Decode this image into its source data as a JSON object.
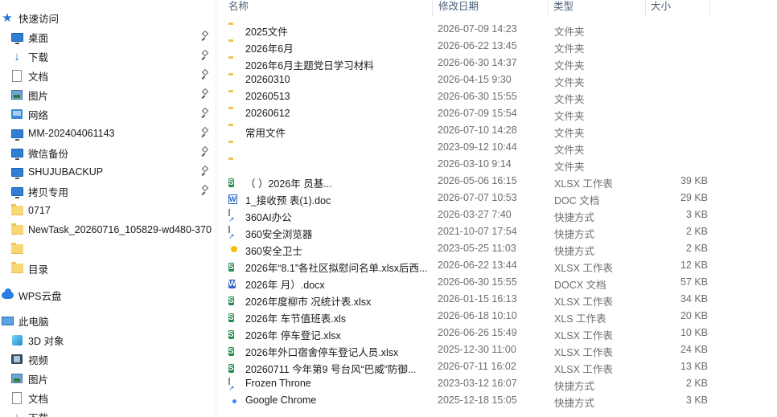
{
  "nav": {
    "quick_access": "快速访问",
    "items": [
      {
        "label": "桌面",
        "icon": "desktop-icon",
        "pinned": true
      },
      {
        "label": "下载",
        "icon": "download-icon",
        "pinned": true
      },
      {
        "label": "文档",
        "icon": "documents-icon",
        "pinned": true
      },
      {
        "label": "图片",
        "icon": "pictures-icon",
        "pinned": true
      },
      {
        "label": "网络",
        "icon": "network-icon",
        "pinned": true
      },
      {
        "label": "MM-202404061143",
        "icon": "computer-icon",
        "pinned": true
      },
      {
        "label": "微信备份",
        "icon": "computer-icon",
        "pinned": true
      },
      {
        "label": "SHUJUBACKUP",
        "icon": "computer-icon",
        "pinned": true
      },
      {
        "label": "拷贝专用",
        "icon": "computer-icon",
        "pinned": true
      },
      {
        "label": "0717",
        "icon": "folder-icon",
        "pinned": false
      },
      {
        "label": "NewTask_20260716_105829-wd480-370",
        "icon": "folder-icon",
        "pinned": false
      },
      {
        "label": "",
        "icon": "folder-icon",
        "pinned": false
      },
      {
        "label": "目录",
        "icon": "folder-icon",
        "pinned": false
      }
    ],
    "wps_cloud": "WPS云盘",
    "this_pc": "此电脑",
    "pc_items": [
      {
        "label": "3D 对象",
        "icon": "3d-objects-icon"
      },
      {
        "label": "视频",
        "icon": "videos-icon"
      },
      {
        "label": "图片",
        "icon": "pictures-icon"
      },
      {
        "label": "文档",
        "icon": "documents-icon"
      },
      {
        "label": "下载",
        "icon": "download-icon"
      }
    ]
  },
  "list": {
    "columns": {
      "name": "名称",
      "date": "修改日期",
      "type": "类型",
      "size": "大小"
    },
    "files": [
      {
        "name": "2025文件",
        "date": "2026-07-09 14:23",
        "type": "文件夹",
        "size": "",
        "icon": "folder-icon"
      },
      {
        "name": "2026年6月",
        "date": "2026-06-22 13:45",
        "type": "文件夹",
        "size": "",
        "icon": "folder-icon"
      },
      {
        "name": "2026年6月主题党日学习材料",
        "date": "2026-06-30 14:37",
        "type": "文件夹",
        "size": "",
        "icon": "folder-icon"
      },
      {
        "name": "20260310",
        "date": "2026-04-15 9:30",
        "type": "文件夹",
        "size": "",
        "icon": "folder-icon"
      },
      {
        "name": "20260513",
        "date": "2026-06-30 15:55",
        "type": "文件夹",
        "size": "",
        "icon": "folder-icon"
      },
      {
        "name": "20260612",
        "date": "2026-07-09 15:54",
        "type": "文件夹",
        "size": "",
        "icon": "folder-icon"
      },
      {
        "name": "常用文件",
        "date": "2026-07-10 14:28",
        "type": "文件夹",
        "size": "",
        "icon": "folder-icon"
      },
      {
        "name": "",
        "date": "2023-09-12 10:44",
        "type": "文件夹",
        "size": "",
        "icon": "folder-icon"
      },
      {
        "name": "",
        "date": "2026-03-10 9:14",
        "type": "文件夹",
        "size": "",
        "icon": "folder-icon"
      },
      {
        "name": "（ ）2026年 员基...",
        "date": "2026-05-06 16:15",
        "type": "XLSX 工作表",
        "size": "39 KB",
        "icon": "xlsx-icon"
      },
      {
        "name": "1_接收预 表(1).doc",
        "date": "2026-07-07 10:53",
        "type": "DOC 文档",
        "size": "29 KB",
        "icon": "doc-icon"
      },
      {
        "name": "360AI办公",
        "date": "2026-03-27 7:40",
        "type": "快捷方式",
        "size": "3 KB",
        "icon": "shortcut-icon"
      },
      {
        "name": "360安全浏览器",
        "date": "2021-10-07 17:54",
        "type": "快捷方式",
        "size": "2 KB",
        "icon": "shortcut-icon"
      },
      {
        "name": "360安全卫士",
        "date": "2023-05-25 11:03",
        "type": "快捷方式",
        "size": "2 KB",
        "icon": "360-security-icon"
      },
      {
        "name": "2026年“8.1”各社区拟慰问名单.xlsx后西...",
        "date": "2026-06-22 13:44",
        "type": "XLSX 工作表",
        "size": "12 KB",
        "icon": "xlsx-icon"
      },
      {
        "name": "2026年 月）.docx",
        "date": "2026-06-30 15:55",
        "type": "DOCX 文档",
        "size": "57 KB",
        "icon": "docx-icon"
      },
      {
        "name": "2026年度柳市 况统计表.xlsx",
        "date": "2026-01-15 16:13",
        "type": "XLSX 工作表",
        "size": "34 KB",
        "icon": "xlsx-icon"
      },
      {
        "name": "2026年 车节值班表.xls",
        "date": "2026-06-18 10:10",
        "type": "XLS 工作表",
        "size": "20 KB",
        "icon": "xlsx-icon"
      },
      {
        "name": "2026年 停车登记.xlsx",
        "date": "2026-06-26 15:49",
        "type": "XLSX 工作表",
        "size": "10 KB",
        "icon": "xlsx-icon"
      },
      {
        "name": "2026年外口宿舍停车登记人员.xlsx",
        "date": "2025-12-30 11:00",
        "type": "XLSX 工作表",
        "size": "24 KB",
        "icon": "xlsx-icon"
      },
      {
        "name": "20260711   今年第9 号台风“巴威”防御...",
        "date": "2026-07-11 16:02",
        "type": "XLSX 工作表",
        "size": "13 KB",
        "icon": "xlsx-icon"
      },
      {
        "name": "Frozen Throne",
        "date": "2023-03-12 16:07",
        "type": "快捷方式",
        "size": "2 KB",
        "icon": "shortcut-icon"
      },
      {
        "name": "Google Chrome",
        "date": "2025-12-18 15:05",
        "type": "快捷方式",
        "size": "3 KB",
        "icon": "chrome-icon"
      }
    ]
  }
}
